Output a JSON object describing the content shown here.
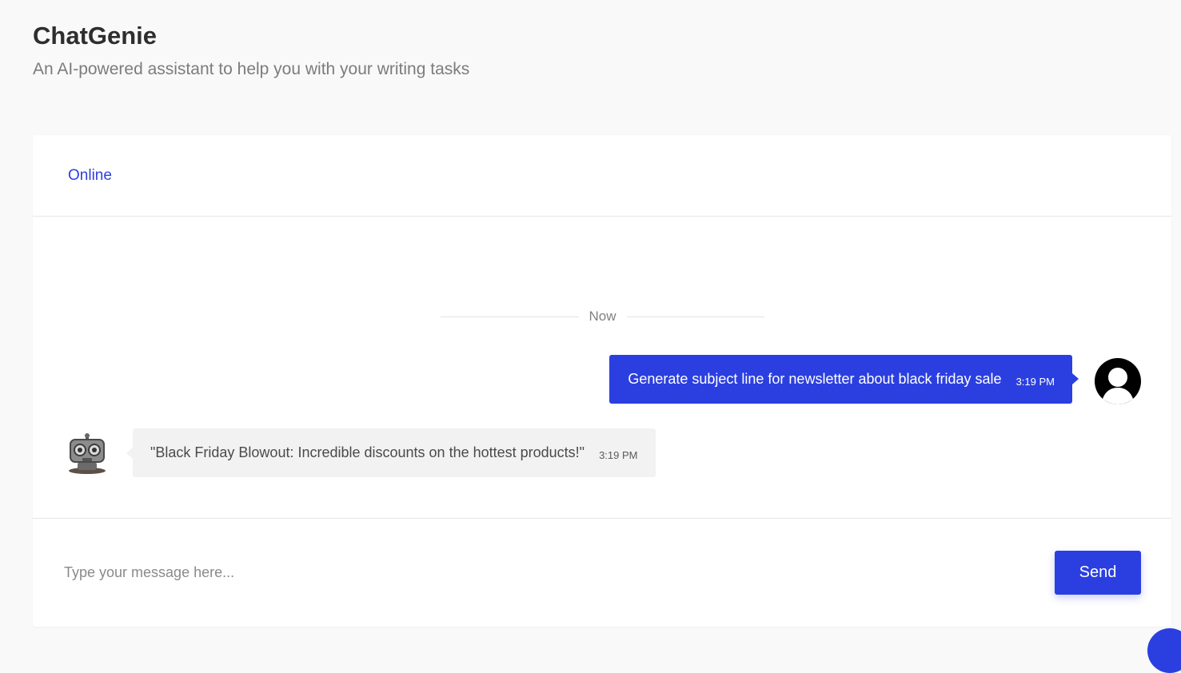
{
  "app": {
    "title": "ChatGenie",
    "subtitle": "An AI-powered assistant to help you with your writing tasks"
  },
  "chat": {
    "status": "Online",
    "divider_label": "Now",
    "messages": [
      {
        "sender": "user",
        "text": "Generate subject line for newsletter about black friday sale",
        "time": "3:19 PM"
      },
      {
        "sender": "bot",
        "text": "\"Black Friday Blowout: Incredible discounts on the hottest products!\"",
        "time": "3:19 PM"
      }
    ]
  },
  "composer": {
    "placeholder": "Type your message here...",
    "value": "",
    "send_label": "Send"
  },
  "colors": {
    "accent": "#2b3fe0",
    "bot_bubble": "#f2f2f2",
    "background": "#f9f9f9"
  },
  "icons": {
    "user_avatar": "user-avatar-icon",
    "bot_avatar": "robot-avatar-icon",
    "fab": "chat-launcher-icon"
  }
}
